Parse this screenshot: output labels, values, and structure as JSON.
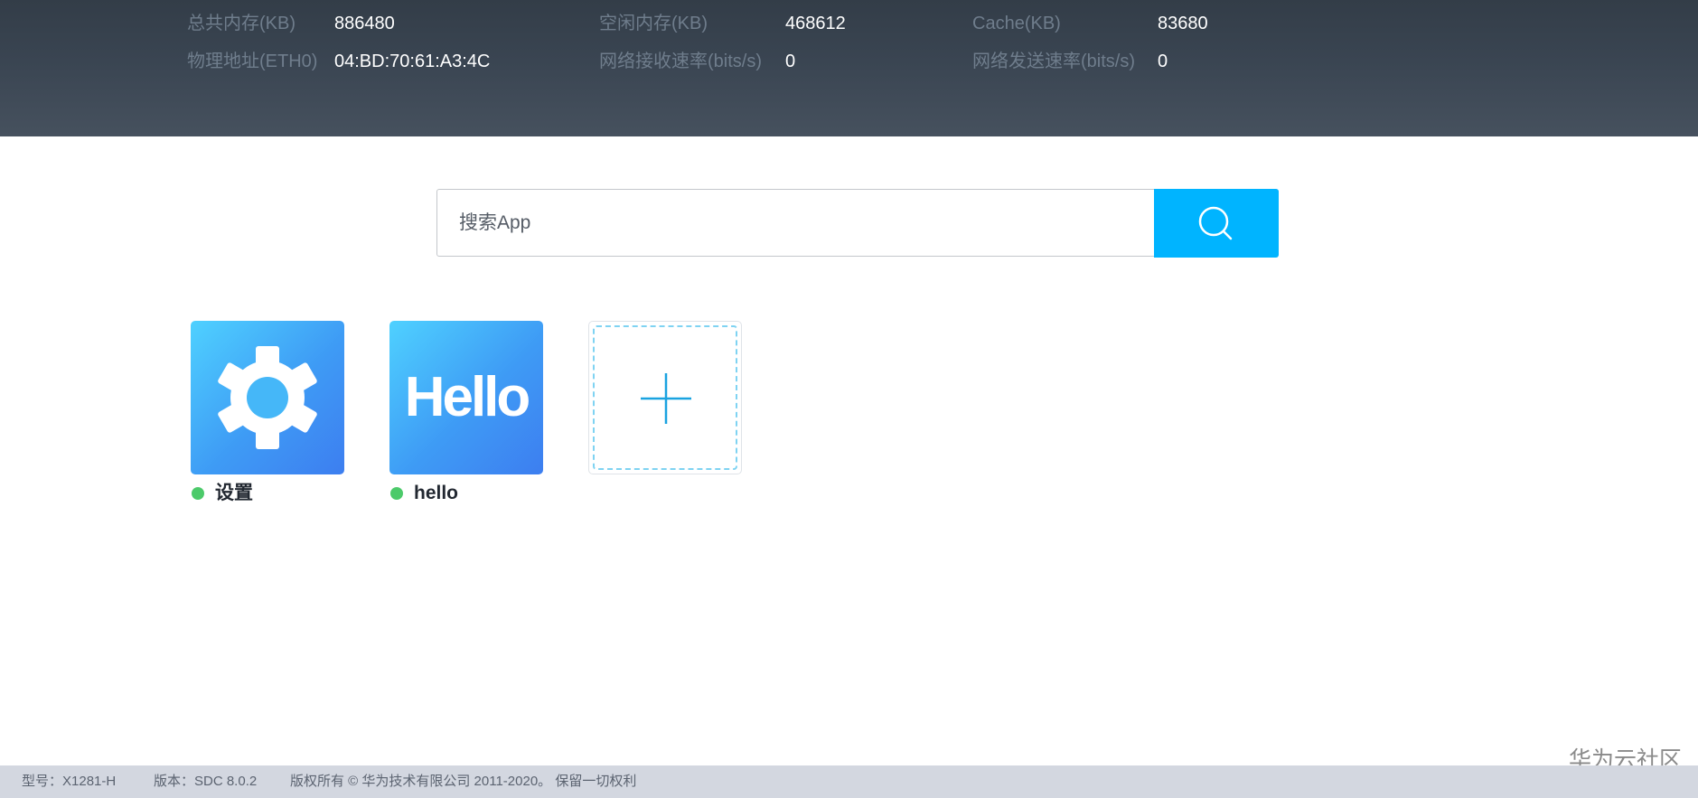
{
  "stats": {
    "total_memory": {
      "label": "总共内存(KB)",
      "value": "886480"
    },
    "free_memory": {
      "label": "空闲内存(KB)",
      "value": "468612"
    },
    "cache": {
      "label": "Cache(KB)",
      "value": "83680"
    },
    "mac_address": {
      "label": "物理地址(ETH0)",
      "value": "04:BD:70:61:A3:4C"
    },
    "rx_rate": {
      "label": "网络接收速率(bits/s)",
      "value": "0"
    },
    "tx_rate": {
      "label": "网络发送速率(bits/s)",
      "value": "0"
    }
  },
  "search": {
    "placeholder": "搜索App",
    "value": "",
    "button_icon": "search-icon"
  },
  "apps": [
    {
      "name": "设置",
      "icon": "gear-icon",
      "status": "running",
      "status_color": "#4cca6a"
    },
    {
      "name": "hello",
      "icon": "hello-icon",
      "icon_text": "Hello",
      "status": "running",
      "status_color": "#4cca6a"
    }
  ],
  "add_app": {
    "icon": "plus-icon"
  },
  "footer": {
    "model": "型号：X1281-H",
    "version": "版本：SDC 8.0.2",
    "copyright": "版权所有 © 华为技术有限公司 2011-2020。 保留一切权利"
  },
  "watermark": "华为云社区",
  "colors": {
    "accent": "#00b4ff",
    "header_bg": "#3a4552",
    "status_ok": "#4cca6a",
    "footer_bg": "#d3d7e0"
  }
}
